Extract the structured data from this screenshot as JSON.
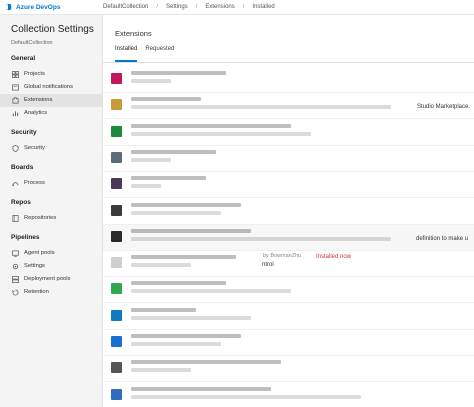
{
  "header": {
    "product": "Azure DevOps",
    "breadcrumbs": [
      "DefaultCollection",
      "Settings",
      "Extensions",
      "Installed"
    ],
    "brand_color": "#0078d4"
  },
  "sidebar": {
    "title": "Collection Settings",
    "subtitle": "DefaultCollection",
    "sections": [
      {
        "label": "General",
        "items": [
          {
            "label": "Projects",
            "icon": "projects-icon"
          },
          {
            "label": "Global notifications",
            "icon": "notifications-icon"
          },
          {
            "label": "Extensions",
            "icon": "extensions-icon",
            "selected": true
          },
          {
            "label": "Analytics",
            "icon": "analytics-icon"
          }
        ]
      },
      {
        "label": "Security",
        "items": [
          {
            "label": "Security",
            "icon": "shield-icon"
          }
        ]
      },
      {
        "label": "Boards",
        "items": [
          {
            "label": "Process",
            "icon": "process-icon"
          }
        ]
      },
      {
        "label": "Repos",
        "items": [
          {
            "label": "Repositories",
            "icon": "repositories-icon"
          }
        ]
      },
      {
        "label": "Pipelines",
        "items": [
          {
            "label": "Agent pools",
            "icon": "agent-pools-icon"
          },
          {
            "label": "Settings",
            "icon": "gear-icon"
          },
          {
            "label": "Deployment pools",
            "icon": "deployment-pools-icon"
          },
          {
            "label": "Retention",
            "icon": "retention-icon"
          }
        ]
      }
    ]
  },
  "main": {
    "title": "Extensions",
    "tabs": [
      {
        "label": "Installed",
        "active": true
      },
      {
        "label": "Requested",
        "active": false
      }
    ],
    "visible_text": {
      "marketplace_snippet": "Studio Marketplace.",
      "definition_snippet": "definition to make u",
      "author": "by BowmanZhu",
      "control_snippet": "ntrol",
      "status": "Installed now"
    },
    "extension_icon_colors": [
      "#c2185b",
      "#c69c3a",
      "#1e8a3c",
      "#5a6b7b",
      "#4a3a5a",
      "#3a3a3a",
      "#2a2a2a",
      "#cfcfcf",
      "#2fa84f",
      "#0e7bbf",
      "#1a6fd0",
      "#555555",
      "#2f6bbf"
    ]
  }
}
